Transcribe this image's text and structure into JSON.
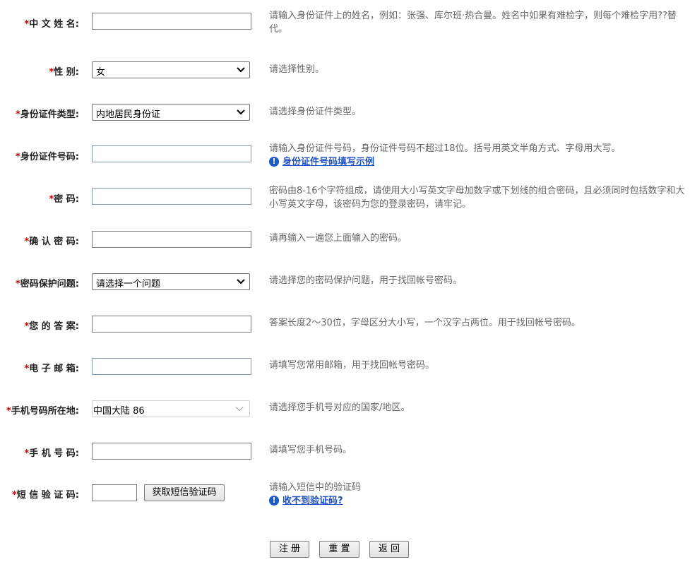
{
  "required_mark": "*",
  "fields": [
    {
      "label": "中 文 姓 名:",
      "help": "请输入身份证件上的姓名，例如：张强、库尔班·热合曼。姓名中如果有难检字，则每个难检字用??替代。"
    },
    {
      "label": "性        别:",
      "value": "女",
      "help": "请选择性别。"
    },
    {
      "label": "身份证件类型:",
      "value": "内地居民身份证",
      "help": "请选择身份证件类型。"
    },
    {
      "label": "身份证件号码:",
      "help": "请输入身份证件号码，身份证件号码不超过18位。括号用英文半角方式、字母用大写。",
      "link": "身份证件号码填写示例"
    },
    {
      "label": "密        码:",
      "help": "密码由8-16个字符组成，请使用大小写英文字母加数字或下划线的组合密码，且必须同时包括数字和大小写英文字母，该密码为您的登录密码，请牢记。"
    },
    {
      "label": "确 认 密 码:",
      "help": "请再输入一遍您上面输入的密码。"
    },
    {
      "label": "密码保护问题:",
      "value": "请选择一个问题",
      "help": "请选择您的密码保护问题，用于找回帐号密码。"
    },
    {
      "label": "您 的 答 案:",
      "help": "答案长度2～30位，字母区分大小写，一个汉字占两位。用于找回帐号密码。"
    },
    {
      "label": "电 子 邮 箱:",
      "help": "请填写您常用邮箱，用于找回帐号密码。"
    },
    {
      "label": "手机号码所在地:",
      "value": "中国大陆 86",
      "help": "请选择您手机号对应的国家/地区。"
    },
    {
      "label": "手 机 号 码:",
      "help": "请填写您手机号码。"
    },
    {
      "label": "短 信 验 证 码:",
      "help": "请输入短信中的验证码",
      "link": "收不到验证码?",
      "button": "获取短信验证码"
    }
  ],
  "info_icon": "!",
  "actions": {
    "register": "注 册",
    "reset": "重 置",
    "back": "返 回"
  },
  "colors": {
    "required": "#cc0000",
    "link": "#1d4fbf",
    "help_text": "#666666"
  }
}
